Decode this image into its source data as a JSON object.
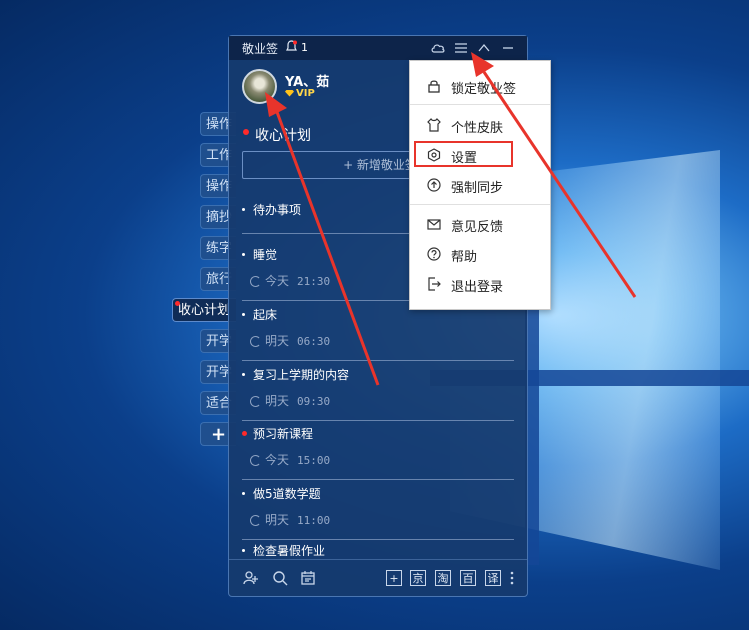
{
  "app": {
    "title": "敬业签",
    "notification_count": "1",
    "user": {
      "name": "YA、茹",
      "badge": "VIP"
    },
    "current_list": "收心计划",
    "add_button": "+ 新增敬业签"
  },
  "sidebar_tabs": [
    {
      "label": "操作"
    },
    {
      "label": "工作"
    },
    {
      "label": "操作"
    },
    {
      "label": "摘抄"
    },
    {
      "label": "练字"
    },
    {
      "label": "旅行"
    },
    {
      "label": "收心计划",
      "active": true
    },
    {
      "label": "开学"
    },
    {
      "label": "开学"
    },
    {
      "label": "适合"
    },
    {
      "label": "+"
    }
  ],
  "notes": [
    {
      "title": "待办事项",
      "day": "",
      "time": ""
    },
    {
      "title": "睡觉",
      "day": "今天",
      "time": "21:30"
    },
    {
      "title": "起床",
      "day": "明天",
      "time": "06:30"
    },
    {
      "title": "复习上学期的内容",
      "day": "明天",
      "time": "09:30"
    },
    {
      "title": "预习新课程",
      "day": "今天",
      "time": "15:00",
      "important": true
    },
    {
      "title": "做5道数学题",
      "day": "明天",
      "time": "11:00"
    },
    {
      "title": "检查暑假作业",
      "day": "",
      "time": ""
    }
  ],
  "menu": {
    "items": [
      {
        "label": "锁定敬业签",
        "icon": "lock-icon"
      },
      {
        "label": "个性皮肤",
        "icon": "shirt-icon"
      },
      {
        "label": "设置",
        "icon": "settings-hex-icon",
        "highlighted": true
      },
      {
        "label": "强制同步",
        "icon": "sync-up-icon"
      },
      {
        "label": "意见反馈",
        "icon": "mail-icon"
      },
      {
        "label": "帮助",
        "icon": "help-icon"
      },
      {
        "label": "退出登录",
        "icon": "logout-icon"
      }
    ]
  },
  "bottom_toolbar": {
    "boxes": [
      "+",
      "京",
      "淘",
      "百",
      "译"
    ]
  },
  "colors": {
    "panel": "#163a6e",
    "accent_red": "#e8342b",
    "vip": "#ffd64a"
  }
}
